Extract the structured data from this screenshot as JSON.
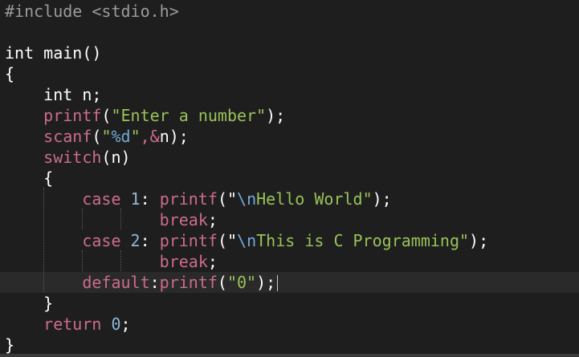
{
  "code": {
    "include_directive": "#include",
    "include_header": "<stdio.h>",
    "main_sig": "int main()",
    "open_main": "{",
    "decl": "int n;",
    "printf1_fn": "printf",
    "printf1_open": "(",
    "printf1_str": "\"Enter a number\"",
    "printf1_close": ");",
    "scanf_fn": "scanf",
    "scanf_open": "(",
    "scanf_str_q1": "\"",
    "scanf_fmt": "%d",
    "scanf_str_q2": "\"",
    "scanf_amp": ",&",
    "scanf_var": "n",
    "scanf_close": ");",
    "switch_kw": "switch",
    "switch_arg": "(n)",
    "open_switch": "{",
    "case1_kw": "case",
    "case1_num": "1",
    "case1_colon": ":",
    "case1_fn": "printf",
    "case1_open": "(\"",
    "case1_esc": "\\n",
    "case1_text": "Hello World\"",
    "case1_close": ");",
    "break1": "break",
    "break1_semi": ";",
    "case2_kw": "case",
    "case2_num": "2",
    "case2_colon": ":",
    "case2_fn": "printf",
    "case2_open": "(\"",
    "case2_esc": "\\n",
    "case2_text": "This is C Programming\"",
    "case2_close": ");",
    "break2": "break",
    "break2_semi": ";",
    "default_kw": "default",
    "default_colon": ":",
    "default_fn": "printf",
    "default_open": "(",
    "default_str": "\"0\"",
    "default_close": ");",
    "close_switch": "}",
    "return_kw": "return",
    "return_val": "0",
    "return_semi": ";",
    "close_main": "}"
  },
  "colors": {
    "background": "#1e1e1e",
    "function": "#cc6d8a",
    "string": "#99c25a",
    "escape": "#72a9d8",
    "preprocessor": "#9b9b9b"
  }
}
